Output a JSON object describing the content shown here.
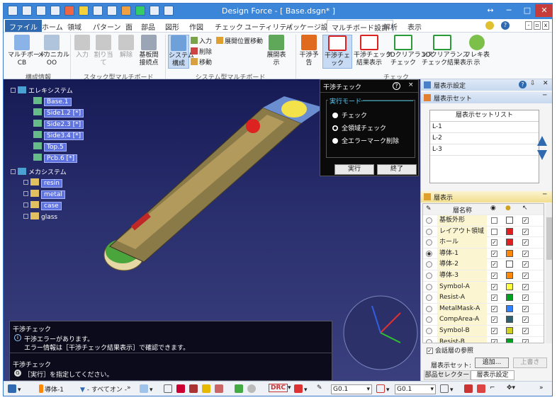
{
  "window": {
    "title": "Design Force - [ Base.dsgn* ]"
  },
  "menu": {
    "tabs": [
      "ファイル",
      "ホーム",
      "領域",
      "パターン",
      "面",
      "部品",
      "図形",
      "作図",
      "チェック",
      "ユーティリティ",
      "パッケージ設計",
      "マルチボード設計",
      "解析",
      "表示"
    ],
    "active": "マルチボード設計"
  },
  "ribbon": {
    "buttons": {
      "multiboard_cb": "マルチボード\nCB",
      "mechanical_oo": "メカニカル\nOO",
      "input": "入力",
      "assign": "割り当て",
      "release": "解除",
      "board_connect": "基板間\n接続点",
      "system_config": "システム\n構成",
      "sys_input": "入力",
      "sys_delete": "削除",
      "sys_move": "移動",
      "expand_pos_move": "展開位置移動",
      "expand_view": "展開表示",
      "interference_forecast": "干渉予告",
      "interference_check": "干渉チェック",
      "interference_result": "干渉チェック\n結果表示",
      "clearance_3d_check": "3Dクリアランス\nチェック",
      "clearance_3d_result": "3Dクリアランス\nチェック結果表示",
      "flex_view": "フレキ表示"
    },
    "groups": {
      "config_info": "構成情報",
      "stack_multi": "スタック型マルチボード",
      "system_multi": "システム型マルチボード",
      "check": "チェック"
    }
  },
  "tree": {
    "electric_root": "エレキシステム",
    "electric_items": [
      "Base.1",
      "Side1.2 [*]",
      "Side2.3 [*]",
      "Side3.4 [*]",
      "Top.5",
      "Pcb.6 [*]"
    ],
    "mech_root": "メカシステム",
    "mech_items": [
      "resin",
      "metal",
      "case",
      "glass"
    ]
  },
  "interference_dialog": {
    "title": "干渉チェック",
    "help": "?",
    "close": "×",
    "mode_label": "実行モード",
    "options": [
      "チェック",
      "全領域チェック",
      "全エラーマーク削除"
    ],
    "selected": 1,
    "run": "実行",
    "end": "終了"
  },
  "messages": {
    "head1": "干渉チェック",
    "line1": "干渉エラーがあります。",
    "line2": "エラー情報は［干渉チェック結果表示］で確認できます。",
    "head2": "干渉チェック",
    "line3": "［実行］を指定してください。"
  },
  "right_panel": {
    "title": "層表示設定",
    "set_section": "層表示セット",
    "list_header": "層表示セットリスト",
    "sets": [
      "L-1",
      "L-2",
      "L-3"
    ],
    "layer_section": "層表示",
    "col_name": "層名称",
    "layers": [
      {
        "name": "基板外形",
        "vis": false,
        "color": "#ffffff",
        "sel": true,
        "active": false
      },
      {
        "name": "レイアウト領域",
        "vis": false,
        "color": "#e02020",
        "sel": true,
        "active": false
      },
      {
        "name": "ホール",
        "vis": true,
        "color": "#e02020",
        "sel": true,
        "active": false
      },
      {
        "name": "導体-1",
        "vis": true,
        "color": "#ff8800",
        "sel": true,
        "active": true
      },
      {
        "name": "導体-2",
        "vis": true,
        "color": "#ffffff",
        "sel": true,
        "active": false
      },
      {
        "name": "導体-3",
        "vis": true,
        "color": "#ff8800",
        "sel": true,
        "active": false
      },
      {
        "name": "Symbol-A",
        "vis": true,
        "color": "#ffff40",
        "sel": true,
        "active": false
      },
      {
        "name": "Resist-A",
        "vis": true,
        "color": "#00a020",
        "sel": true,
        "active": false
      },
      {
        "name": "MetalMask-A",
        "vis": true,
        "color": "#3080ff",
        "sel": true,
        "active": false
      },
      {
        "name": "CompArea-A",
        "vis": true,
        "color": "#2f6070",
        "sel": true,
        "active": false
      },
      {
        "name": "Symbol-B",
        "vis": true,
        "color": "#d0d020",
        "sel": true,
        "active": false
      },
      {
        "name": "Resist-B",
        "vis": true,
        "color": "#00a020",
        "sel": true,
        "active": false
      }
    ],
    "conversation_ref": "会話層の参照",
    "display_set_label": "層表示セット:",
    "add_btn": "追加...",
    "overwrite_btn": "上書き",
    "tab1": "部品セレクター",
    "tab2": "層表示設定"
  },
  "statusbar": {
    "layer": "導体-1",
    "filter": "- すべてオン -",
    "drc": "DRC",
    "grid1": "G0.1",
    "grid2": "G0.1"
  }
}
